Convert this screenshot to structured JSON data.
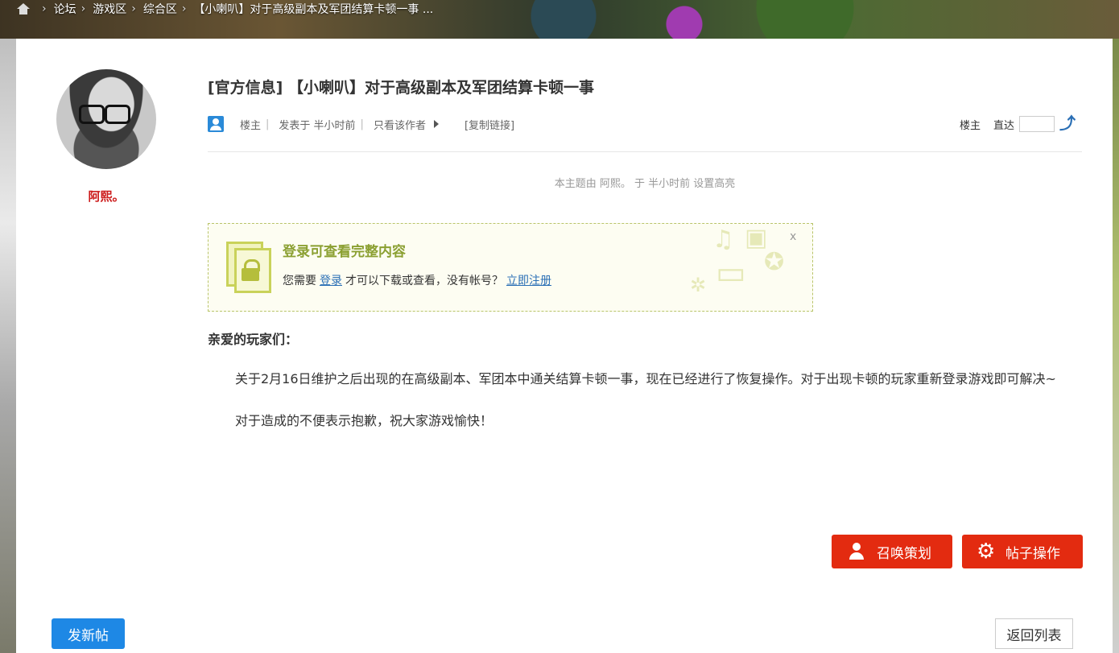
{
  "breadcrumb": {
    "items": [
      "论坛",
      "游戏区",
      "综合区",
      "【小喇叭】对于高级副本及军团结算卡顿一事 ..."
    ]
  },
  "author": {
    "name": "阿熙。"
  },
  "post": {
    "title": "[官方信息] 【小喇叭】对于高级副本及军团结算卡顿一事",
    "meta": {
      "floor_owner": "楼主",
      "posted": "发表于 半小时前",
      "only_author": "只看该作者",
      "copy_link": "[复制链接]"
    },
    "jump": {
      "floor_label": "楼主",
      "goto_label": "直达",
      "input_value": ""
    },
    "highlight_note": "本主题由 阿熙。 于 半小时前 设置高亮",
    "greeting": "亲爱的玩家们：",
    "paragraph1": "关于2月16日维护之后出现的在高级副本、军团本中通关结算卡顿一事，现在已经进行了恢复操作。对于出现卡顿的玩家重新登录游戏即可解决~",
    "paragraph2": "对于造成的不便表示抱歉，祝大家游戏愉快！"
  },
  "login_notice": {
    "title": "登录可查看完整内容",
    "text_before": "您需要",
    "login_link": "登录",
    "text_middle": "才可以下载或查看，没有帐号？",
    "register_link": "立即注册",
    "close": "x"
  },
  "actions": {
    "summon": "召唤策划",
    "post_ops": "帖子操作",
    "new_post": "发新帖",
    "back_list": "返回列表"
  },
  "colors": {
    "accent_red": "#e32b10",
    "primary_blue": "#1e88e5",
    "author_red": "#cc1a1a",
    "login_green": "#8ba032"
  }
}
